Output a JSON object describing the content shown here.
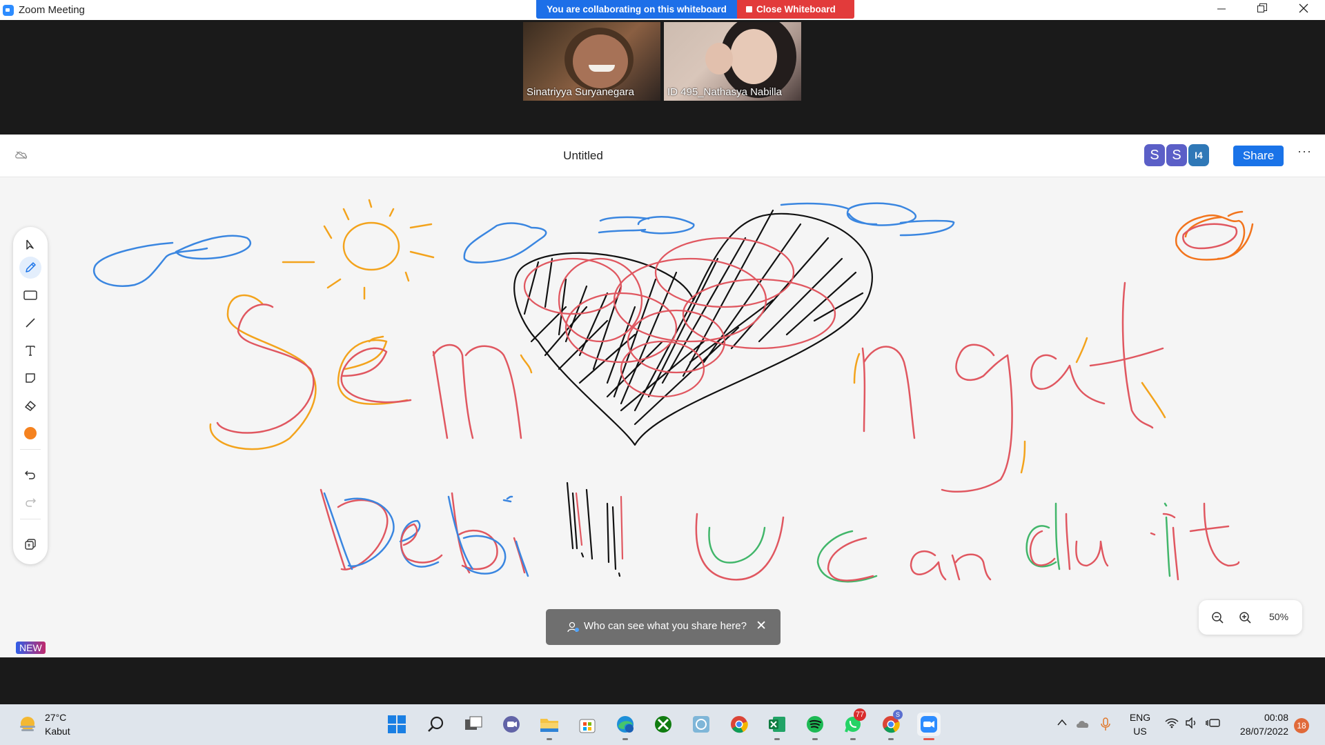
{
  "window": {
    "title": "Zoom Meeting",
    "collab_banner": "You are collaborating on this whiteboard",
    "close_whiteboard": "Close Whiteboard",
    "controls": [
      "minimize",
      "restore",
      "close"
    ]
  },
  "participants": [
    {
      "name": "Sinatriyya Suryanegara"
    },
    {
      "name": "ID 495_Nathasya Nabilla"
    }
  ],
  "whiteboard": {
    "title": "Untitled",
    "avatars": [
      {
        "initial": "S",
        "color": "#5b5fc7"
      },
      {
        "initial": "S",
        "color": "#5b5fc7"
      },
      {
        "initial": "I4",
        "color": "#2f78b7"
      }
    ],
    "share_label": "Share",
    "more_label": "···",
    "tools": [
      "select-icon",
      "pen-icon",
      "rectangle-icon",
      "line-icon",
      "text-icon",
      "sticky-note-icon",
      "eraser-icon",
      "color-dot-icon",
      "undo-icon",
      "redo-icon",
      "templates-icon"
    ],
    "pen_color": "#f5821f",
    "new_badge": "NEW",
    "toast": "Who can see what you share here?",
    "toast_close": "✕",
    "zoom_level": "50%",
    "colors": {
      "blue": "#3a86e0",
      "red": "#e05760",
      "orange": "#f3a31c",
      "black": "#111111",
      "green": "#41b66a",
      "dark_orange": "#f2741c"
    }
  },
  "taskbar": {
    "temperature": "27°C",
    "weather": "Kabut",
    "apps": [
      "windows-start-icon",
      "search-icon",
      "task-view-icon",
      "teams-chat-icon",
      "file-explorer-icon",
      "microsoft-store-icon",
      "edge-icon",
      "xbox-icon",
      "photos-icon",
      "chrome-icon",
      "excel-icon",
      "spotify-icon",
      "whatsapp-icon",
      "chrome-profile-icon",
      "zoom-icon"
    ],
    "whatsapp_badge": "77",
    "chrome_profile_badge": "S",
    "language": "ENG",
    "region": "US",
    "time": "00:08",
    "date": "28/07/2022",
    "notifications": "18"
  }
}
